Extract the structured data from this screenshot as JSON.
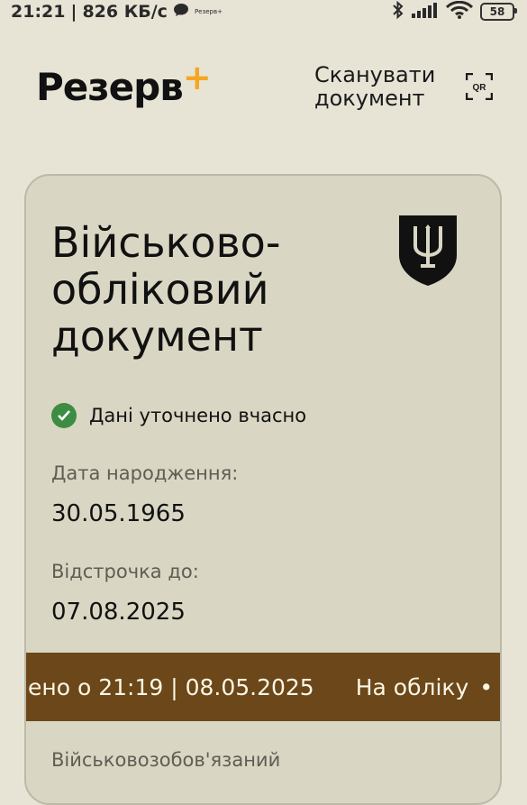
{
  "status_bar": {
    "time": "21:21",
    "net_speed": "826 КБ/с",
    "mini_app_label": "Резерв+",
    "battery": "58"
  },
  "header": {
    "logo_text": "Резерв",
    "logo_plus": "+",
    "scan_label_line1": "Сканувати",
    "scan_label_line2": "документ",
    "qr_text": "QR"
  },
  "card": {
    "title_line1": "Військово-",
    "title_line2": "обліковий",
    "title_line3": "документ",
    "status_text": "Дані уточнено вчасно",
    "birth_label": "Дата народження:",
    "birth_value": "30.05.1965",
    "deferral_label": "Відстрочка до:",
    "deferral_value": "07.08.2025",
    "ticker_update": "ено о 21:19 | 08.05.2025",
    "ticker_status": "На обліку",
    "ticker_dot": "•",
    "category_label": "Військовозобов'язаний"
  },
  "colors": {
    "background": "#e7e4d6",
    "card": "#d9d6c3",
    "ticker_bg": "#6b4719",
    "accent_plus": "#f5a623",
    "check_green": "#3d8c43"
  },
  "icons": [
    "chat-bubble-icon",
    "bluetooth-icon",
    "signal-icon",
    "wifi-icon",
    "battery-icon",
    "qr-scan-icon",
    "trident-emblem-icon",
    "check-circle-icon"
  ]
}
